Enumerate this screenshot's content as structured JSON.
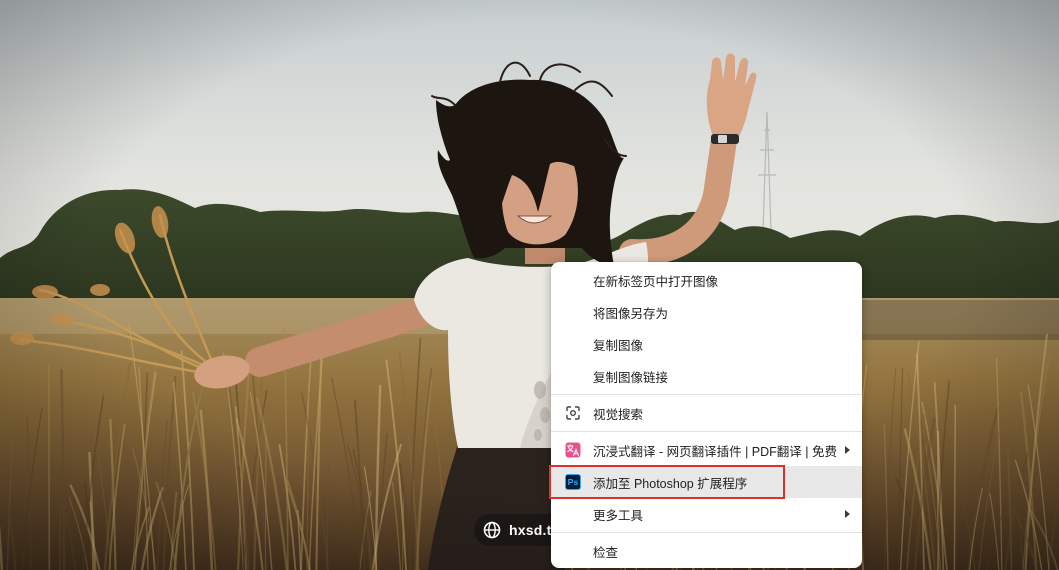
{
  "watermark": {
    "text": "hxsd.tv",
    "icon": "globe-icon"
  },
  "context_menu": {
    "items": [
      {
        "label": "在新标签页中打开图像"
      },
      {
        "label": "将图像另存为"
      },
      {
        "label": "复制图像"
      },
      {
        "label": "复制图像链接"
      },
      {
        "label": "视觉搜索",
        "icon": "lens-icon"
      },
      {
        "label": "沉浸式翻译 - 网页翻译插件 | PDF翻译 | 免费",
        "icon": "immersive-translate-icon",
        "submenu": true
      },
      {
        "label": "添加至 Photoshop 扩展程序",
        "icon": "photoshop-icon",
        "icon_text": "Ps",
        "highlighted": true,
        "outlined": true
      },
      {
        "label": "更多工具",
        "submenu": true
      },
      {
        "label": "检查"
      }
    ]
  },
  "colors": {
    "annotation_outline": "#d8322e",
    "menu_highlight": "#e8e8e9",
    "photoshop_icon_bg": "#001e36",
    "photoshop_icon_fg": "#31a8ff",
    "translate_icon_bg": "#e9508d"
  }
}
